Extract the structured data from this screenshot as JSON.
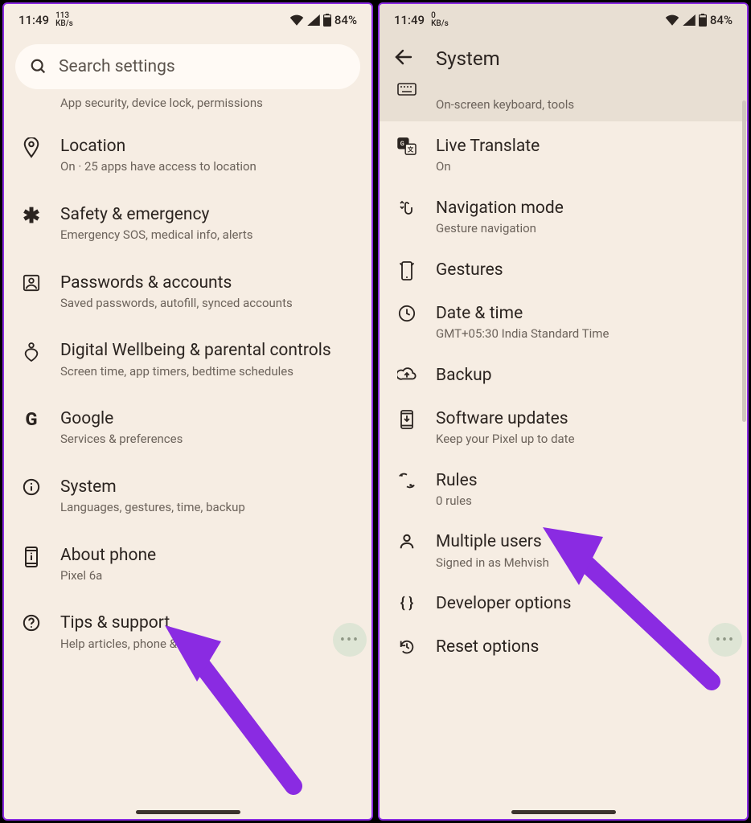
{
  "status": {
    "time": "11:49",
    "net_left_top": "113",
    "net_left_unit": "KB/s",
    "net_right_top": "0",
    "net_right_unit": "KB/s",
    "battery": "84%"
  },
  "left": {
    "search_placeholder": "Search settings",
    "peek_sub": "App security, device lock, permissions",
    "rows": [
      {
        "id": "location",
        "title": "Location",
        "sub": "On · 25 apps have access to location"
      },
      {
        "id": "safety",
        "title": "Safety & emergency",
        "sub": "Emergency SOS, medical info, alerts"
      },
      {
        "id": "passwords",
        "title": "Passwords & accounts",
        "sub": "Saved passwords, autofill, synced accounts"
      },
      {
        "id": "wellbeing",
        "title": "Digital Wellbeing & parental controls",
        "sub": "Screen time, app timers, bedtime schedules"
      },
      {
        "id": "google",
        "title": "Google",
        "sub": "Services & preferences"
      },
      {
        "id": "system",
        "title": "System",
        "sub": "Languages, gestures, time, backup"
      },
      {
        "id": "about",
        "title": "About phone",
        "sub": "Pixel 6a"
      },
      {
        "id": "tips",
        "title": "Tips & support",
        "sub": "Help articles, phone & chat"
      }
    ]
  },
  "right": {
    "header_title": "System",
    "peek_sub": "On-screen keyboard, tools",
    "rows": [
      {
        "id": "live-translate",
        "title": "Live Translate",
        "sub": "On"
      },
      {
        "id": "nav-mode",
        "title": "Navigation mode",
        "sub": "Gesture navigation"
      },
      {
        "id": "gestures",
        "title": "Gestures",
        "sub": ""
      },
      {
        "id": "date-time",
        "title": "Date & time",
        "sub": "GMT+05:30 India Standard Time"
      },
      {
        "id": "backup",
        "title": "Backup",
        "sub": ""
      },
      {
        "id": "software-updates",
        "title": "Software updates",
        "sub": "Keep your Pixel up to date"
      },
      {
        "id": "rules",
        "title": "Rules",
        "sub": "0 rules"
      },
      {
        "id": "multiple-users",
        "title": "Multiple users",
        "sub": "Signed in as Mehvish"
      },
      {
        "id": "developer",
        "title": "Developer options",
        "sub": ""
      },
      {
        "id": "reset",
        "title": "Reset options",
        "sub": ""
      }
    ]
  }
}
